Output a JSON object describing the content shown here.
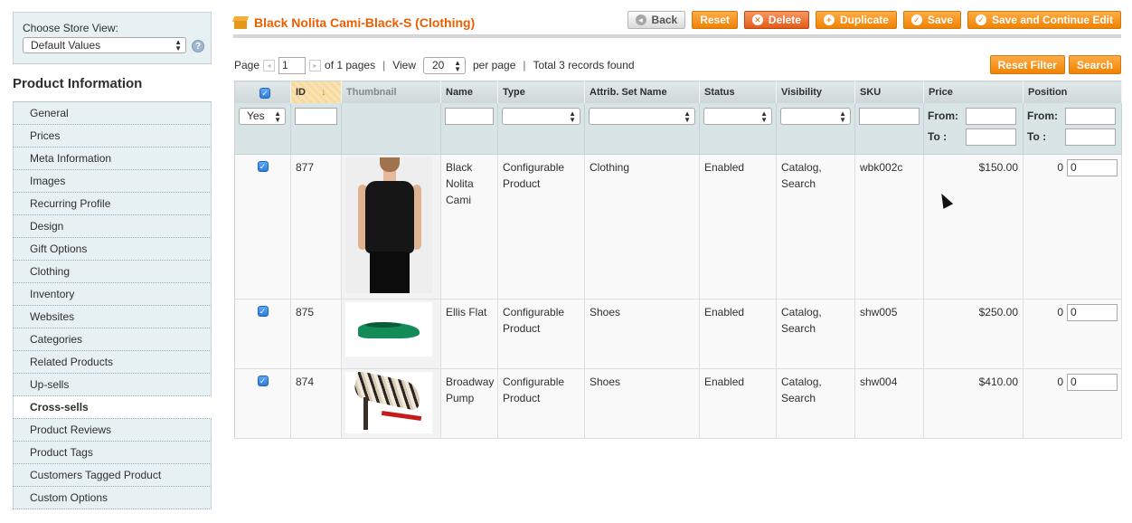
{
  "sidebar": {
    "store_label": "Choose Store View:",
    "store_value": "Default Values",
    "help_icon": "?",
    "section_title": "Product Information",
    "tabs": [
      {
        "label": "General"
      },
      {
        "label": "Prices"
      },
      {
        "label": "Meta Information"
      },
      {
        "label": "Images"
      },
      {
        "label": "Recurring Profile"
      },
      {
        "label": "Design"
      },
      {
        "label": "Gift Options"
      },
      {
        "label": "Clothing"
      },
      {
        "label": "Inventory"
      },
      {
        "label": "Websites"
      },
      {
        "label": "Categories"
      },
      {
        "label": "Related Products"
      },
      {
        "label": "Up-sells"
      },
      {
        "label": "Cross-sells"
      },
      {
        "label": "Product Reviews"
      },
      {
        "label": "Product Tags"
      },
      {
        "label": "Customers Tagged Product"
      },
      {
        "label": "Custom Options"
      }
    ],
    "active_tab": "Cross-sells"
  },
  "header": {
    "title": "Black Nolita Cami-Black-S (Clothing)",
    "buttons": {
      "back": "Back",
      "reset": "Reset",
      "delete": "Delete",
      "duplicate": "Duplicate",
      "save": "Save",
      "save_continue": "Save and Continue Edit"
    }
  },
  "pager": {
    "page_label": "Page",
    "page_value": "1",
    "of_pages": "of 1 pages",
    "view_label": "View",
    "view_value": "20",
    "per_page": "per page",
    "total": "Total 3 records found",
    "separator": "|",
    "reset_filter": "Reset Filter",
    "search": "Search"
  },
  "grid": {
    "columns": {
      "id": "ID",
      "thumbnail": "Thumbnail",
      "name": "Name",
      "type": "Type",
      "attrib_set": "Attrib. Set Name",
      "status": "Status",
      "visibility": "Visibility",
      "sku": "SKU",
      "price": "Price",
      "position": "Position"
    },
    "filter": {
      "in_products": "Yes",
      "from_label": "From:",
      "to_label": "To :"
    },
    "rows": [
      {
        "id": "877",
        "name": "Black Nolita Cami",
        "type": "Configurable Product",
        "attrib_set": "Clothing",
        "status": "Enabled",
        "visibility": "Catalog, Search",
        "sku": "wbk002c",
        "price": "$150.00",
        "position": "0",
        "position_input": "0"
      },
      {
        "id": "875",
        "name": "Ellis Flat",
        "type": "Configurable Product",
        "attrib_set": "Shoes",
        "status": "Enabled",
        "visibility": "Catalog, Search",
        "sku": "shw005",
        "price": "$250.00",
        "position": "0",
        "position_input": "0"
      },
      {
        "id": "874",
        "name": "Broadway Pump",
        "type": "Configurable Product",
        "attrib_set": "Shoes",
        "status": "Enabled",
        "visibility": "Catalog, Search",
        "sku": "shw004",
        "price": "$410.00",
        "position": "0",
        "position_input": "0"
      }
    ]
  },
  "colors": {
    "accent": "#eb5e00",
    "button_orange": "#f18200",
    "sidebar_bg": "#e7f1f4"
  }
}
